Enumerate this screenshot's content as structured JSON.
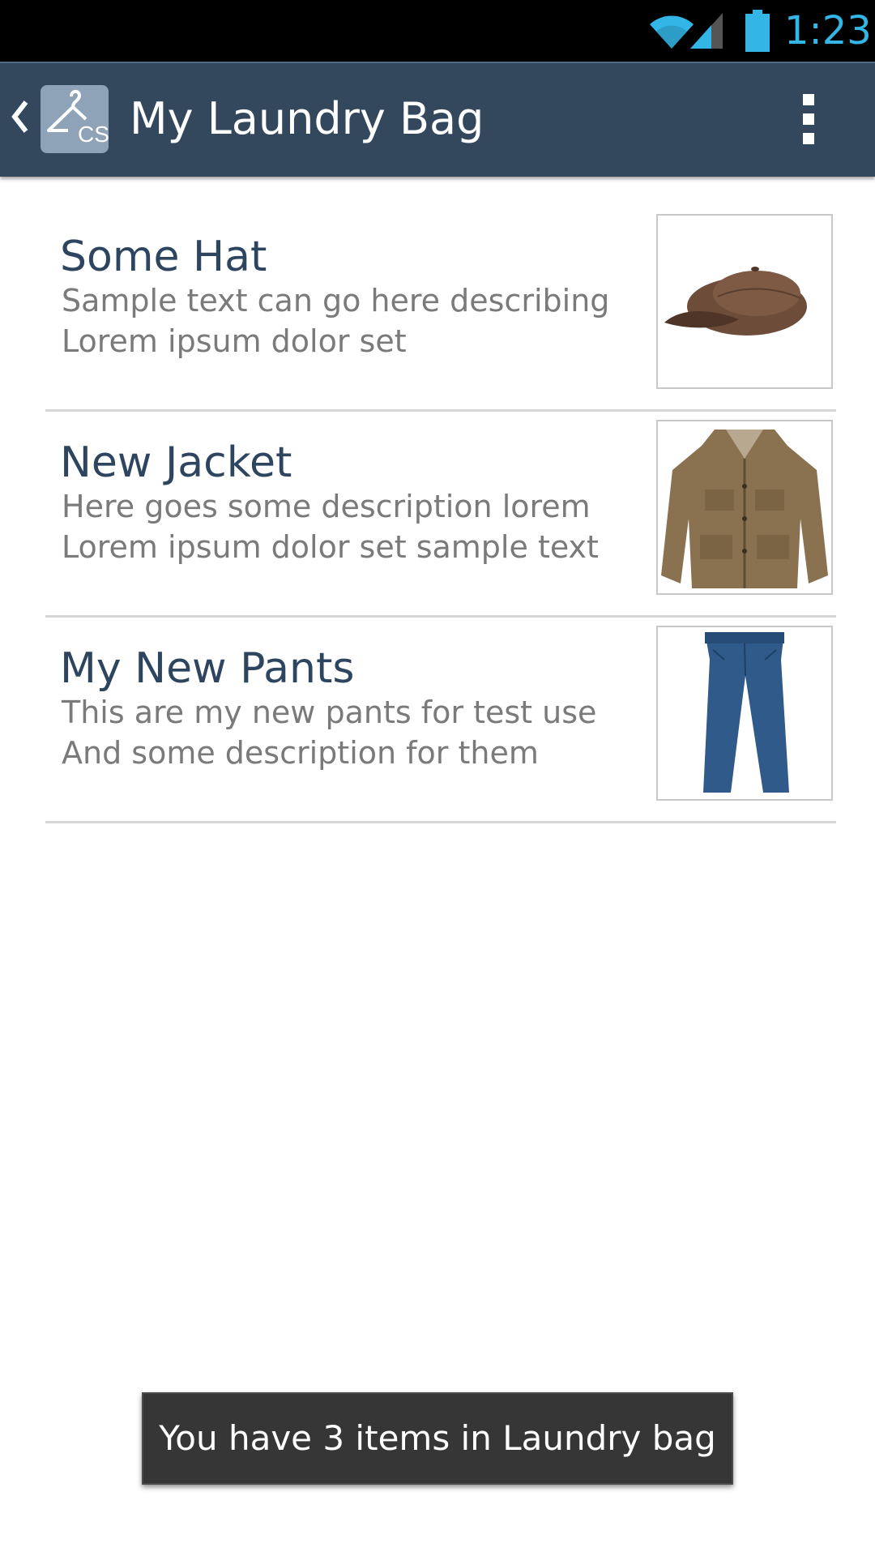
{
  "status_bar": {
    "time": "1:23",
    "icons": [
      "wifi-icon",
      "cell-signal-icon",
      "battery-icon"
    ],
    "accent_color": "#33b5e5"
  },
  "action_bar": {
    "title": "My Laundry Bag",
    "app_icon": "hanger-logo-icon",
    "app_icon_text": "CS",
    "up_icon": "chevron-left-icon",
    "menu_icon": "overflow-menu-icon",
    "background_color": "#33475d"
  },
  "items": [
    {
      "title": "Some Hat",
      "desc_line1": "Sample text can go here describing",
      "desc_line2": "Lorem ipsum dolor set",
      "image_icon": "hat-icon"
    },
    {
      "title": "New Jacket",
      "desc_line1": "Here goes some description lorem",
      "desc_line2": "Lorem ipsum dolor set sample text",
      "image_icon": "jacket-icon"
    },
    {
      "title": "My New Pants",
      "desc_line1": "This are my new pants for test use",
      "desc_line2": "And some description for them",
      "image_icon": "pants-icon"
    }
  ],
  "toast": {
    "message": "You have 3 items in Laundry bag"
  }
}
